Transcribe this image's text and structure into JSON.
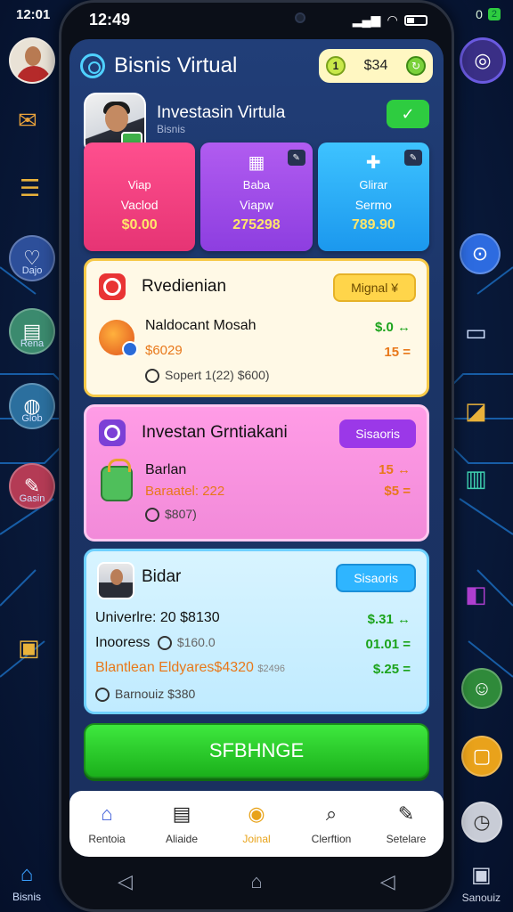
{
  "outer": {
    "time": "12:01",
    "right_status": "0",
    "battery": "2",
    "left_labels": [
      "Dajo",
      "Rena",
      "Glob",
      "Gasin"
    ],
    "bottom_left_label": "Bisnis",
    "bottom_right_label": "Sanouiz"
  },
  "phone_status": {
    "time": "12:49"
  },
  "header": {
    "title": "Bisnis Virtual",
    "coin_icon_text": "1",
    "coin_value": "$34"
  },
  "profile": {
    "name": "Investasin Virtula",
    "subtitle": "Bisnis"
  },
  "stats": [
    {
      "label": "Viap",
      "unit": "Vaclod",
      "value": "$0.00"
    },
    {
      "label": "Baba",
      "unit": "Viapw",
      "value": "275298"
    },
    {
      "label": "Glirar",
      "unit": "Sermo",
      "value": "789.90"
    }
  ],
  "card1": {
    "title": "Rvedienian",
    "button": "Mignal ¥",
    "item_name": "Naldocant Mosah",
    "item_price": "$6029",
    "item_note": "Sopert 1(22) $600)",
    "amount1": "$.0 ↔",
    "amount2": "15 ="
  },
  "card2": {
    "title": "Investan Grntiakani",
    "button": "Sisaoris",
    "item_name": "Barlan",
    "item_price": "Baraatel: 222",
    "item_note": "$807)",
    "amount1": "15 ↔",
    "amount2": "$5 ="
  },
  "card3": {
    "title": "Bidar",
    "button": "Sisaoris",
    "rows": [
      {
        "label": "Univerlre: 20 $8130",
        "note": "",
        "amount": "$.31 ↔"
      },
      {
        "label": "Inooress",
        "note": "$160.0",
        "amount": "01.01 ="
      },
      {
        "label": "Blantlean Eldyares$4320",
        "note": "$2496",
        "amount": "$.25 ="
      }
    ],
    "footer": "Barnouiz $380"
  },
  "big_button": "SFBHNGE",
  "bottom_nav": [
    {
      "label": "Rentoia",
      "icon": "house-icon"
    },
    {
      "label": "Aliaide",
      "icon": "clipboard-icon"
    },
    {
      "label": "Joinal",
      "icon": "coin-icon"
    },
    {
      "label": "Clerftion",
      "icon": "search-icon"
    },
    {
      "label": "Setelare",
      "icon": "tools-icon"
    }
  ],
  "colors": {
    "accent_green": "#2ecc40",
    "card_pink": "#ff4f8e",
    "card_purple": "#b15cf0",
    "card_blue": "#3ec3ff"
  }
}
